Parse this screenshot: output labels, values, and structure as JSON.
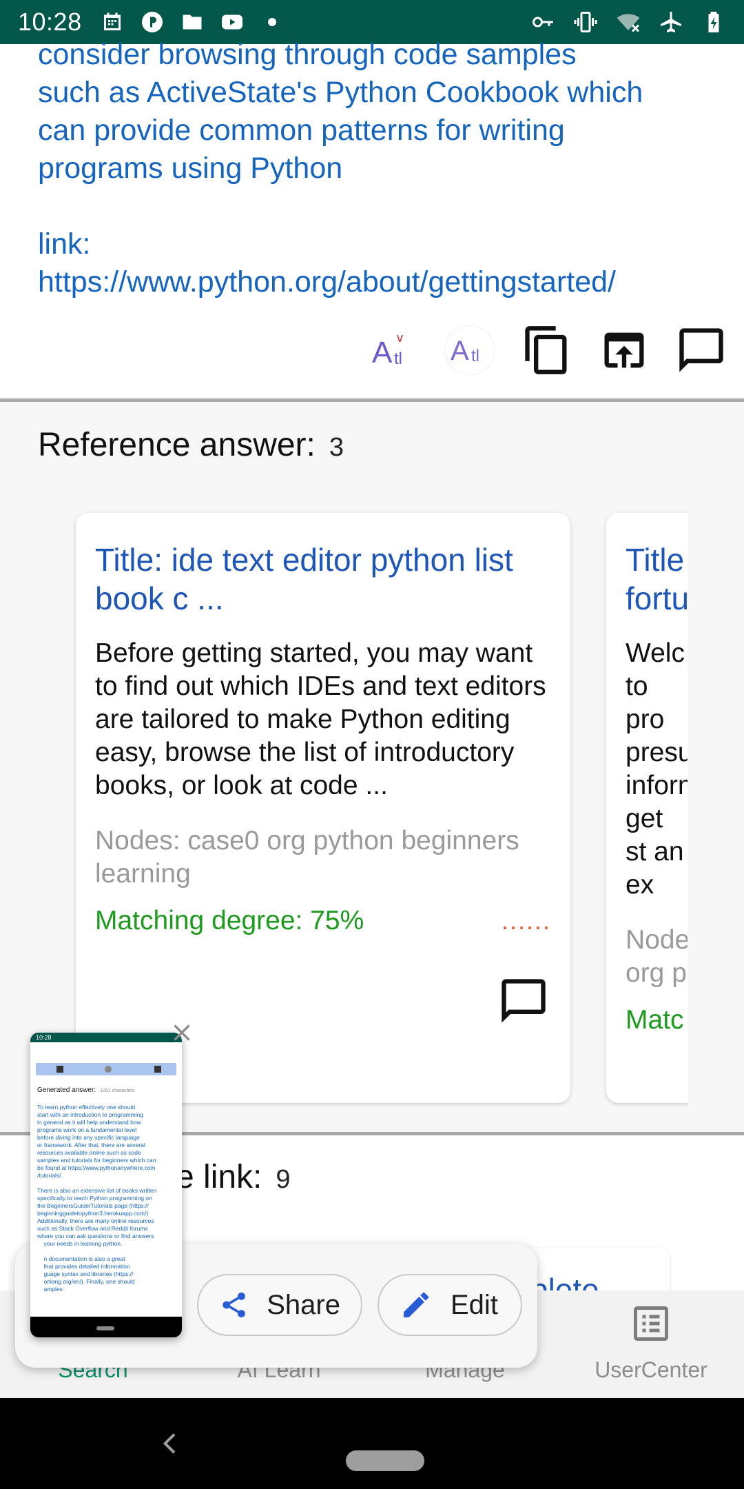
{
  "status_bar": {
    "time": "10:28",
    "left_icons": [
      "calendar-icon",
      "app-p-icon",
      "folder-icon",
      "youtube-icon",
      "dot-icon"
    ],
    "right_icons": [
      "key-icon",
      "vibrate-icon",
      "wifi-off-icon",
      "airplane-icon",
      "battery-charging-icon"
    ]
  },
  "generated": {
    "text": "consider browsing through code samples\nsuch as ActiveState's Python Cookbook which\ncan provide common patterns for writing\nprograms using Python\n\nlink:\nhttps://www.python.org/about/gettingstarted/"
  },
  "actions": [
    "font-style-v-icon",
    "font-style-icon",
    "copy-icon",
    "open-external-icon",
    "comment-icon"
  ],
  "reference": {
    "heading": "Reference answer:",
    "count": "3",
    "cards": [
      {
        "title": "Title: ide text editor python list book c ...",
        "body": "Before getting started, you may want to find out which IDEs and text editors are tailored to make Python editing easy, browse the list of introductory books, or look at code  ...",
        "nodes": "Nodes: case0 org python beginners learning",
        "match": "Matching degree: 75%",
        "dots": "......"
      },
      {
        "title": "Title fortu",
        "body": "Welc to pro presu inform get st an ex",
        "nodes": "Node org p",
        "match": "Matc",
        "dots": ""
      }
    ]
  },
  "link_section": {
    "heading": "e link:",
    "count": "9",
    "peek_title": "plete"
  },
  "bottom_nav": {
    "items": [
      {
        "label": "Search",
        "active": true
      },
      {
        "label": "AI Learn",
        "active": false
      },
      {
        "label": "Manage",
        "active": false
      },
      {
        "label": "UserCenter",
        "active": false
      }
    ]
  },
  "screenshot_toolbar": {
    "share_label": "Share",
    "edit_label": "Edit"
  },
  "thumbnail": {
    "time": "10:28",
    "heading": "Generated answer:",
    "chars": "1061 characters",
    "text": "To learn python effectively one should\nstart with an introduction to programming\nin general as it will help understand how\nprograms work on a fundamental level\nbefore diving into any specific language\nor framework. After that, there are several\nresources available online such as code\nsamples and tutorials for beginners which can\nbe found at https://www.pythonanywhere.com\n/tutorials/.\n\nThere is also an extensive list of books written\nspecifically to teach Python programming on\nthe BeginnersGuide/Tutorials page (https://\nbeginningguidetopython3.herokuapp.com/)\nAdditionally, there are many online resources\nsuch as Stack Overflow and Reddit forums\nwhere you can ask questions or find answers\n    your needs in learning python.\n\n    n documentation is also a great\n    that provides detailed information\n    guage syntax and libraries (https://\n    onlang.org/en/). Finally, one should\n    amples"
  }
}
